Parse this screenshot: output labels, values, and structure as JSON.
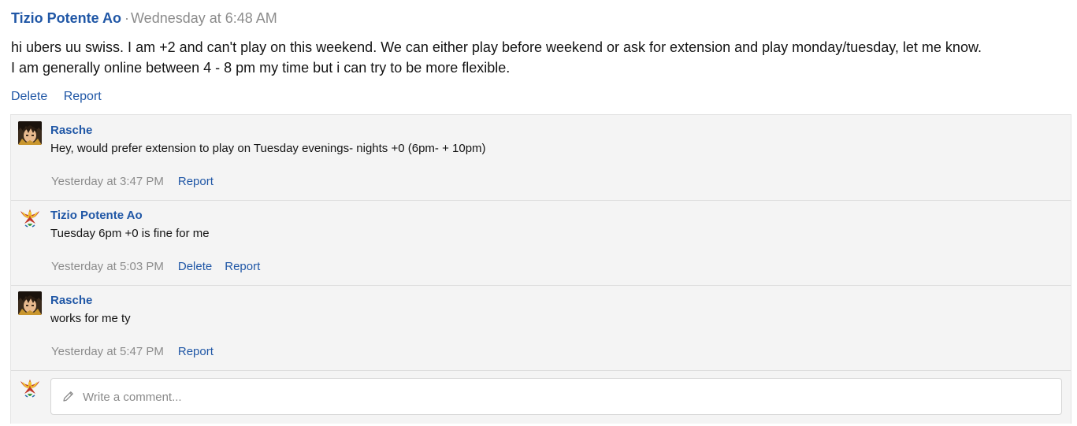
{
  "post": {
    "author": "Tizio Potente Ao",
    "separator": "·",
    "date": "Wednesday at 6:48 AM",
    "body_line1": "hi ubers uu swiss. I am +2 and can't play on this weekend. We can either play before weekend or ask for extension and play monday/tuesday, let me know.",
    "body_line2": "I am generally online between 4 - 8 pm my time but i can try to be more flexible.",
    "actions": {
      "delete": "Delete",
      "report": "Report"
    }
  },
  "comments": [
    {
      "author": "Rasche",
      "text": "Hey, would prefer extension to play on Tuesday evenings- nights +0 (6pm- + 10pm)",
      "date": "Yesterday at 3:47 PM",
      "report": "Report",
      "avatar_icon": "anime-character-avatar-icon"
    },
    {
      "author": "Tizio Potente Ao",
      "text": "Tuesday 6pm +0 is fine for me",
      "date": "Yesterday at 5:03 PM",
      "delete": "Delete",
      "report": "Report",
      "avatar_icon": "phoenix-bird-avatar-icon"
    },
    {
      "author": "Rasche",
      "text": "works for me ty",
      "date": "Yesterday at 5:47 PM",
      "report": "Report",
      "avatar_icon": "anime-character-avatar-icon"
    }
  ],
  "reply": {
    "placeholder": "Write a comment...",
    "avatar_icon": "phoenix-bird-avatar-icon",
    "input_icon": "pencil-icon"
  },
  "colors": {
    "link": "#2057a6",
    "muted": "#8c8c8c",
    "comment_bg": "#f4f4f4"
  }
}
